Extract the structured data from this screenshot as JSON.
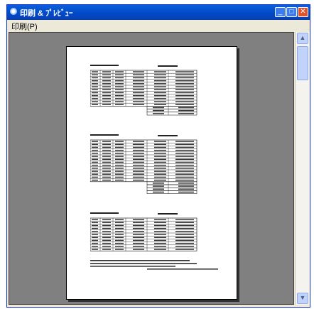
{
  "window": {
    "title": "印刷 & ﾌﾟﾚﾋﾞｭｰ",
    "menu_label": "印刷(P)",
    "colors": {
      "titlebar": "#0a5fd8",
      "preview_bg": "#808080"
    },
    "icons": [
      "app-icon",
      "minimize-icon",
      "maximize-icon",
      "close-icon",
      "chevron-up-icon",
      "chevron-down-icon"
    ]
  }
}
